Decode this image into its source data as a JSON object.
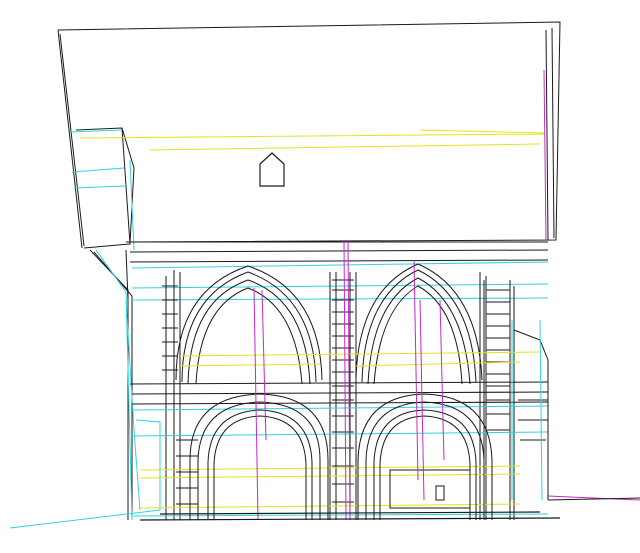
{
  "drawing": {
    "background": "#ffffff",
    "line_colors": {
      "outline": "#1a1a1a",
      "cyan": "#2fd3e0",
      "yellow": "#e8e21a",
      "magenta": "#c02cc8"
    }
  }
}
